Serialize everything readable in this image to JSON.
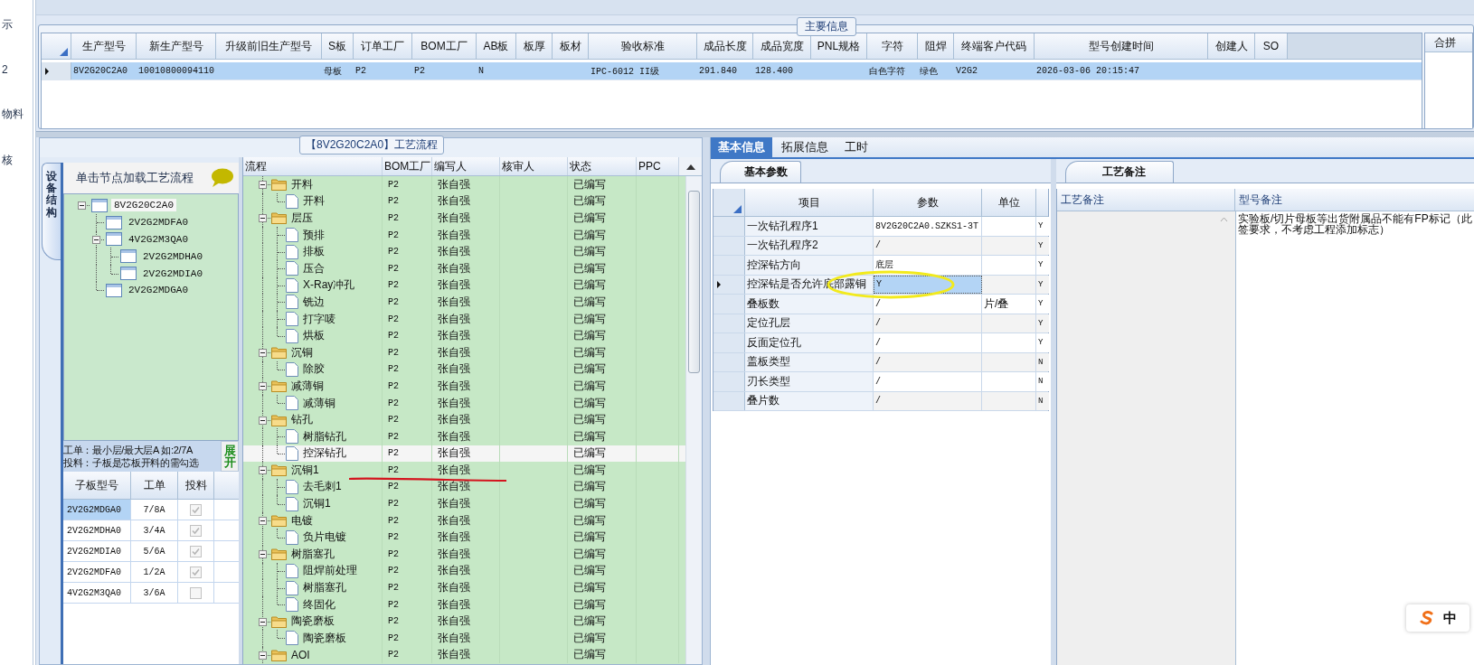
{
  "left_strip": {
    "items": [
      "示",
      "2",
      "物料",
      "核"
    ]
  },
  "main_info": {
    "legend": "主要信息",
    "columns": [
      "生产型号",
      "新生产型号",
      "升级前旧生产型号",
      "S板",
      "订单工厂",
      "BOM工厂",
      "AB板",
      "板厚",
      "板材",
      "验收标准",
      "成品长度",
      "成品宽度",
      "PNL规格",
      "字符",
      "阻焊",
      "终端客户代码",
      "型号创建时间",
      "创建人",
      "SO"
    ],
    "rows": [
      {
        "selected": true,
        "cells": [
          "8V2G20C2A0",
          "10010800094110",
          null,
          "母板",
          "P2",
          "P2",
          "N",
          null,
          null,
          "IPC-6012 II级",
          "291.840",
          "128.400",
          null,
          "白色字符",
          "绿色",
          "V2G2",
          "2026-03-06 20:15:47",
          null,
          null
        ]
      }
    ],
    "side_panel": {
      "title": "合拼"
    }
  },
  "process": {
    "title": "【8V2G20C2A0】工艺流程",
    "side_tab": "设备结构",
    "tree_hint": "单击节点加载工艺流程",
    "tree": [
      {
        "label": "8V2G20C2A0",
        "selected": true,
        "expanded": true,
        "children": [
          {
            "label": "2V2G2MDFA0",
            "selected": false
          },
          {
            "label": "4V2G2M3QA0",
            "selected": false,
            "expanded": true,
            "children": [
              {
                "label": "2V2G2MDHA0",
                "selected": false
              },
              {
                "label": "2V2G2MDIA0",
                "selected": false
              }
            ]
          },
          {
            "label": "2V2G2MDGA0",
            "selected": false
          }
        ]
      }
    ],
    "note_lines": [
      "工单：最小层/最大层A 如:2/7A",
      "投料：子板是芯板开料的需勾选"
    ],
    "expand_button": "展开",
    "sub_table": {
      "columns": [
        "子板型号",
        "工单",
        "投料"
      ],
      "rows": [
        {
          "model": "2V2G2MDGA0",
          "order": "7/8A",
          "feed": true,
          "selected": true
        },
        {
          "model": "2V2G2MDHA0",
          "order": "3/4A",
          "feed": true,
          "selected": false
        },
        {
          "model": "2V2G2MDIA0",
          "order": "5/6A",
          "feed": true,
          "selected": false
        },
        {
          "model": "2V2G2MDFA0",
          "order": "1/2A",
          "feed": true,
          "selected": false
        },
        {
          "model": "4V2G2M3QA0",
          "order": "3/6A",
          "feed": false,
          "selected": false
        }
      ]
    },
    "flow": {
      "columns": [
        "流程",
        "BOM工厂",
        "编写人",
        "核审人",
        "状态",
        "PPC"
      ],
      "rows": [
        {
          "kind": "group",
          "name": "开料",
          "bom": "P2",
          "writer": "张自强",
          "status": "已编写",
          "selected": false,
          "expanded": true,
          "children": [
            {
              "kind": "step",
              "name": "开料",
              "bom": "P2",
              "writer": "张自强",
              "status": "已编写",
              "selected": false
            }
          ]
        },
        {
          "kind": "group",
          "name": "层压",
          "bom": "P2",
          "writer": "张自强",
          "status": "已编写",
          "selected": false,
          "expanded": true,
          "children": [
            {
              "kind": "step",
              "name": "预排",
              "bom": "P2",
              "writer": "张自强",
              "status": "已编写",
              "selected": false
            },
            {
              "kind": "step",
              "name": "排板",
              "bom": "P2",
              "writer": "张自强",
              "status": "已编写",
              "selected": false
            },
            {
              "kind": "step",
              "name": "压合",
              "bom": "P2",
              "writer": "张自强",
              "status": "已编写",
              "selected": false
            },
            {
              "kind": "step",
              "name": "X-Ray冲孔",
              "bom": "P2",
              "writer": "张自强",
              "status": "已编写",
              "selected": false
            },
            {
              "kind": "step",
              "name": "铣边",
              "bom": "P2",
              "writer": "张自强",
              "status": "已编写",
              "selected": false
            },
            {
              "kind": "step",
              "name": "打字唛",
              "bom": "P2",
              "writer": "张自强",
              "status": "已编写",
              "selected": false
            },
            {
              "kind": "step",
              "name": "烘板",
              "bom": "P2",
              "writer": "张自强",
              "status": "已编写",
              "selected": false
            }
          ]
        },
        {
          "kind": "group",
          "name": "沉铜",
          "bom": "P2",
          "writer": "张自强",
          "status": "已编写",
          "selected": false,
          "expanded": true,
          "children": [
            {
              "kind": "step",
              "name": "除胶",
              "bom": "P2",
              "writer": "张自强",
              "status": "已编写",
              "selected": false
            }
          ]
        },
        {
          "kind": "group",
          "name": "减薄铜",
          "bom": "P2",
          "writer": "张自强",
          "status": "已编写",
          "selected": false,
          "expanded": true,
          "children": [
            {
              "kind": "step",
              "name": "减薄铜",
              "bom": "P2",
              "writer": "张自强",
              "status": "已编写",
              "selected": false
            }
          ]
        },
        {
          "kind": "group",
          "name": "钻孔",
          "bom": "P2",
          "writer": "张自强",
          "status": "已编写",
          "selected": false,
          "expanded": true,
          "children": [
            {
              "kind": "step",
              "name": "树脂钻孔",
              "bom": "P2",
              "writer": "张自强",
              "status": "已编写",
              "selected": false
            },
            {
              "kind": "step",
              "name": "控深钻孔",
              "bom": "P2",
              "writer": "张自强",
              "status": "已编写",
              "selected": true
            }
          ]
        },
        {
          "kind": "group",
          "name": "沉铜1",
          "bom": "P2",
          "writer": "张自强",
          "status": "已编写",
          "selected": false,
          "expanded": true,
          "children": [
            {
              "kind": "step",
              "name": "去毛刺1",
              "bom": "P2",
              "writer": "张自强",
              "status": "已编写",
              "selected": false
            },
            {
              "kind": "step",
              "name": "沉铜1",
              "bom": "P2",
              "writer": "张自强",
              "status": "已编写",
              "selected": false
            }
          ]
        },
        {
          "kind": "group",
          "name": "电镀",
          "bom": "P2",
          "writer": "张自强",
          "status": "已编写",
          "selected": false,
          "expanded": true,
          "children": [
            {
              "kind": "step",
              "name": "负片电镀",
              "bom": "P2",
              "writer": "张自强",
              "status": "已编写",
              "selected": false
            }
          ]
        },
        {
          "kind": "group",
          "name": "树脂塞孔",
          "bom": "P2",
          "writer": "张自强",
          "status": "已编写",
          "selected": false,
          "expanded": true,
          "children": [
            {
              "kind": "step",
              "name": "阻焊前处理",
              "bom": "P2",
              "writer": "张自强",
              "status": "已编写",
              "selected": false
            },
            {
              "kind": "step",
              "name": "树脂塞孔",
              "bom": "P2",
              "writer": "张自强",
              "status": "已编写",
              "selected": false
            },
            {
              "kind": "step",
              "name": "终固化",
              "bom": "P2",
              "writer": "张自强",
              "status": "已编写",
              "selected": false
            }
          ]
        },
        {
          "kind": "group",
          "name": "陶瓷磨板",
          "bom": "P2",
          "writer": "张自强",
          "status": "已编写",
          "selected": false,
          "expanded": true,
          "children": [
            {
              "kind": "step",
              "name": "陶瓷磨板",
              "bom": "P2",
              "writer": "张自强",
              "status": "已编写",
              "selected": false
            }
          ]
        },
        {
          "kind": "group",
          "name": "AOI",
          "bom": "P2",
          "writer": "张自强",
          "status": "已编写",
          "selected": false,
          "expanded": true
        }
      ]
    }
  },
  "detail": {
    "tabs": [
      {
        "label": "基本信息",
        "selected": true
      },
      {
        "label": "拓展信息",
        "selected": false
      },
      {
        "label": "工时",
        "selected": false
      }
    ],
    "params": {
      "tab": "基本参数",
      "columns": [
        "项目",
        "参数",
        "单位"
      ],
      "rows": [
        {
          "item": "一次钻孔程序1",
          "value": "8V2G20C2A0.SZKS1-3T",
          "flag": "Y",
          "selected": false
        },
        {
          "item": "一次钻孔程序2",
          "value": "/",
          "flag": "Y",
          "selected": false
        },
        {
          "item": "控深钻方向",
          "value": "底层",
          "flag": "Y",
          "selected": false
        },
        {
          "item": "控深钻是否允许底部露铜",
          "value": "Y",
          "flag": "Y",
          "selected": true
        },
        {
          "item": "叠板数",
          "value": "/",
          "unit": "片/叠",
          "flag": "Y",
          "selected": false
        },
        {
          "item": "定位孔层",
          "value": "/",
          "flag": "Y",
          "selected": false
        },
        {
          "item": "反面定位孔",
          "value": "/",
          "flag": "Y",
          "selected": false
        },
        {
          "item": "盖板类型",
          "value": "/",
          "flag": "N",
          "selected": false
        },
        {
          "item": "刃长类型",
          "value": "/",
          "flag": "N",
          "selected": false
        },
        {
          "item": "叠片数",
          "value": "/",
          "flag": "N",
          "selected": false
        }
      ]
    },
    "notes": {
      "tab": "工艺备注",
      "columns": [
        "工艺备注",
        "型号备注"
      ],
      "model_note_lines": [
        "实验板/切片母板等出货附属品不能有FP标记（此",
        "签要求，不考虑工程添加标志）"
      ]
    }
  },
  "ime": {
    "mode": "中"
  }
}
